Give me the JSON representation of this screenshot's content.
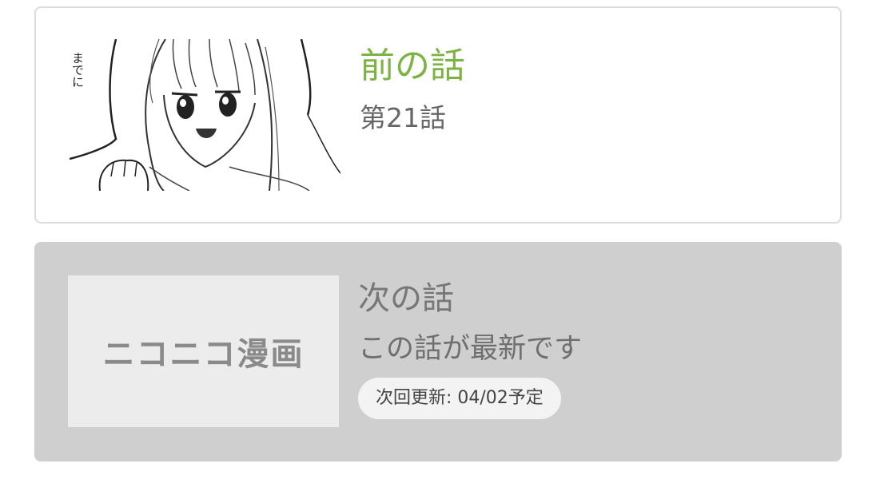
{
  "prev_episode": {
    "heading": "前の話",
    "episode_title": "第21話",
    "thumbnail_text": "までに",
    "heading_color": "#7cb342"
  },
  "next_episode": {
    "heading": "次の話",
    "status": "この話が最新です",
    "next_update": "次回更新: 04/02予定",
    "placeholder_logo": "ニコニコ漫画"
  }
}
